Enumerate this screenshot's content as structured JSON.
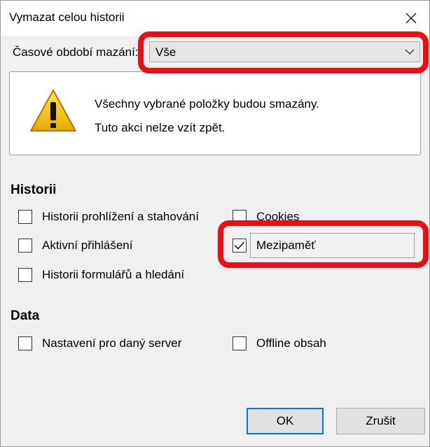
{
  "dialog": {
    "title": "Vymazat celou historii"
  },
  "time_range": {
    "label": "Časové období mazání:",
    "selected": "Vše"
  },
  "warning": {
    "line1": "Všechny vybrané položky budou smazány.",
    "line2": "Tuto akci nelze vzít zpět."
  },
  "history": {
    "heading": "Historii",
    "items": [
      {
        "label": "Historii prohlížení a stahování",
        "checked": false
      },
      {
        "label": "Cookies",
        "checked": false
      },
      {
        "label": "Aktivní přihlášení",
        "checked": false
      },
      {
        "label": "Mezipaměť",
        "checked": true
      },
      {
        "label": "Historii formulářů a hledání",
        "checked": false
      }
    ]
  },
  "data_section": {
    "heading": "Data",
    "items": [
      {
        "label": "Nastavení pro daný server",
        "checked": false
      },
      {
        "label": "Offline obsah",
        "checked": false
      }
    ]
  },
  "buttons": {
    "ok": "OK",
    "cancel": "Zrušit"
  },
  "colors": {
    "highlight_ring": "#ee0d15",
    "focus_accent": "#0078d7",
    "warning_yellow": "#f5c700"
  },
  "icons": {
    "warning": "warning-triangle-icon",
    "close": "close-icon",
    "dropdown": "chevron-down-icon",
    "check": "checkmark-icon"
  }
}
